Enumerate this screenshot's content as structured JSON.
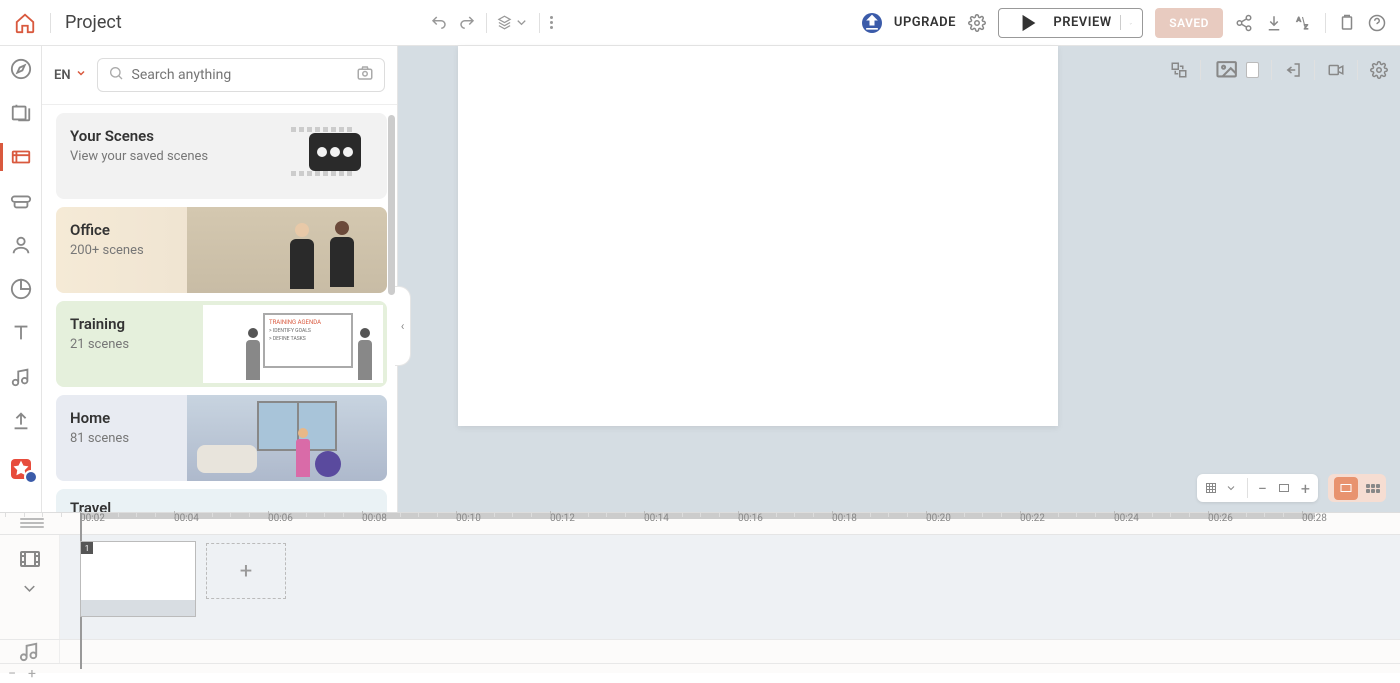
{
  "header": {
    "title": "Project",
    "upgrade": "UPGRADE",
    "preview": "PREVIEW",
    "saved": "SAVED"
  },
  "library": {
    "lang": "EN",
    "search_placeholder": "Search anything",
    "cards": [
      {
        "title": "Your Scenes",
        "sub": "View your saved scenes"
      },
      {
        "title": "Office",
        "sub": "200+ scenes"
      },
      {
        "title": "Training",
        "sub": "21 scenes"
      },
      {
        "title": "Home",
        "sub": "81 scenes"
      },
      {
        "title": "Travel",
        "sub": ""
      }
    ],
    "whiteboard": {
      "header": "TRAINING AGENDA",
      "l1": "> IDENTIFY GOALS",
      "l2": "> DEFINE TASKS"
    }
  },
  "timeline": {
    "ticks": [
      "00:02",
      "00:04",
      "00:06",
      "00:08",
      "00:10",
      "00:12",
      "00:14",
      "00:16",
      "00:18",
      "00:20",
      "00:22",
      "00:24",
      "00:26",
      "00:28"
    ],
    "scene_number": "1"
  }
}
